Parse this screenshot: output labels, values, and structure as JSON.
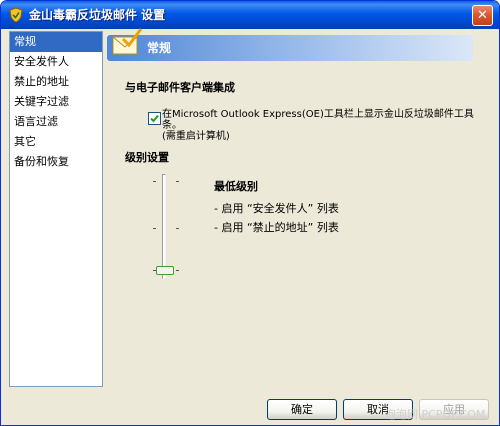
{
  "window": {
    "title": "金山毒霸反垃圾邮件 设置",
    "close_symbol": "✕"
  },
  "sidebar": {
    "items": [
      {
        "label": "常规",
        "selected": true
      },
      {
        "label": "安全发件人",
        "selected": false
      },
      {
        "label": "禁止的地址",
        "selected": false
      },
      {
        "label": "关键字过滤",
        "selected": false
      },
      {
        "label": "语言过滤",
        "selected": false
      },
      {
        "label": "其它",
        "selected": false
      },
      {
        "label": "备份和恢复",
        "selected": false
      }
    ]
  },
  "header": {
    "title": "常规",
    "icon": "envelope-check-icon"
  },
  "integration": {
    "section_title": "与电子邮件客户端集成",
    "checkbox_checked": true,
    "checkbox_label_line1": "在Microsoft Outlook Express(OE)工具栏上显示金山反垃圾邮件工具条。",
    "checkbox_label_line2": "(需重启计算机)"
  },
  "level": {
    "section_title": "级别设置",
    "slider_level": 0,
    "level_name": "最低级别",
    "details": [
      "-  启用 “安全发件人” 列表",
      "-  启用 “禁止的地址” 列表"
    ]
  },
  "buttons": {
    "ok_label": "确定",
    "cancel_label": "取消",
    "apply_label": "应用"
  },
  "watermark": "泡泡网 PCPOP.COM",
  "colors": {
    "titlebar": "#0058e6",
    "selection": "#316ac5",
    "window_bg": "#ece9d8"
  }
}
